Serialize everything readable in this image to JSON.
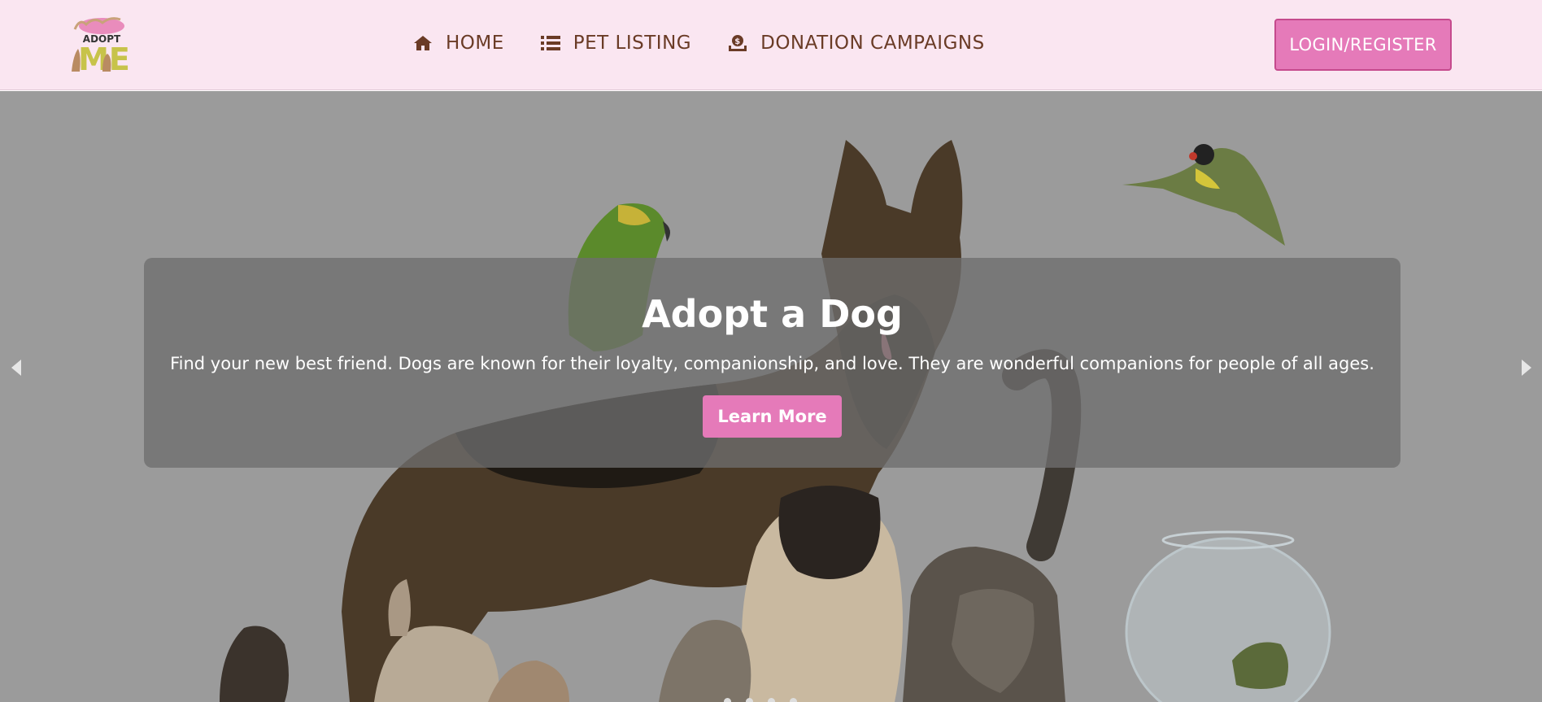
{
  "brand": {
    "logo_text_top": "ADOPT",
    "logo_text_bottom": "ME"
  },
  "nav": {
    "items": [
      {
        "label": "HOME",
        "icon": "home-icon"
      },
      {
        "label": "PET LISTING",
        "icon": "list-icon"
      },
      {
        "label": "DONATION CAMPAIGNS",
        "icon": "donation-icon"
      }
    ],
    "login_label": "LOGIN/REGISTER"
  },
  "hero": {
    "title": "Adopt a Dog",
    "description": "Find your new best friend. Dogs are known for their loyalty, companionship, and love. They are wonderful companions for people of all ages.",
    "button_label": "Learn More",
    "slide_count": 4,
    "active_slide": 1
  },
  "colors": {
    "nav_bg": "#fae6f1",
    "accent": "#e57ab9",
    "nav_text": "#6a3b26"
  }
}
